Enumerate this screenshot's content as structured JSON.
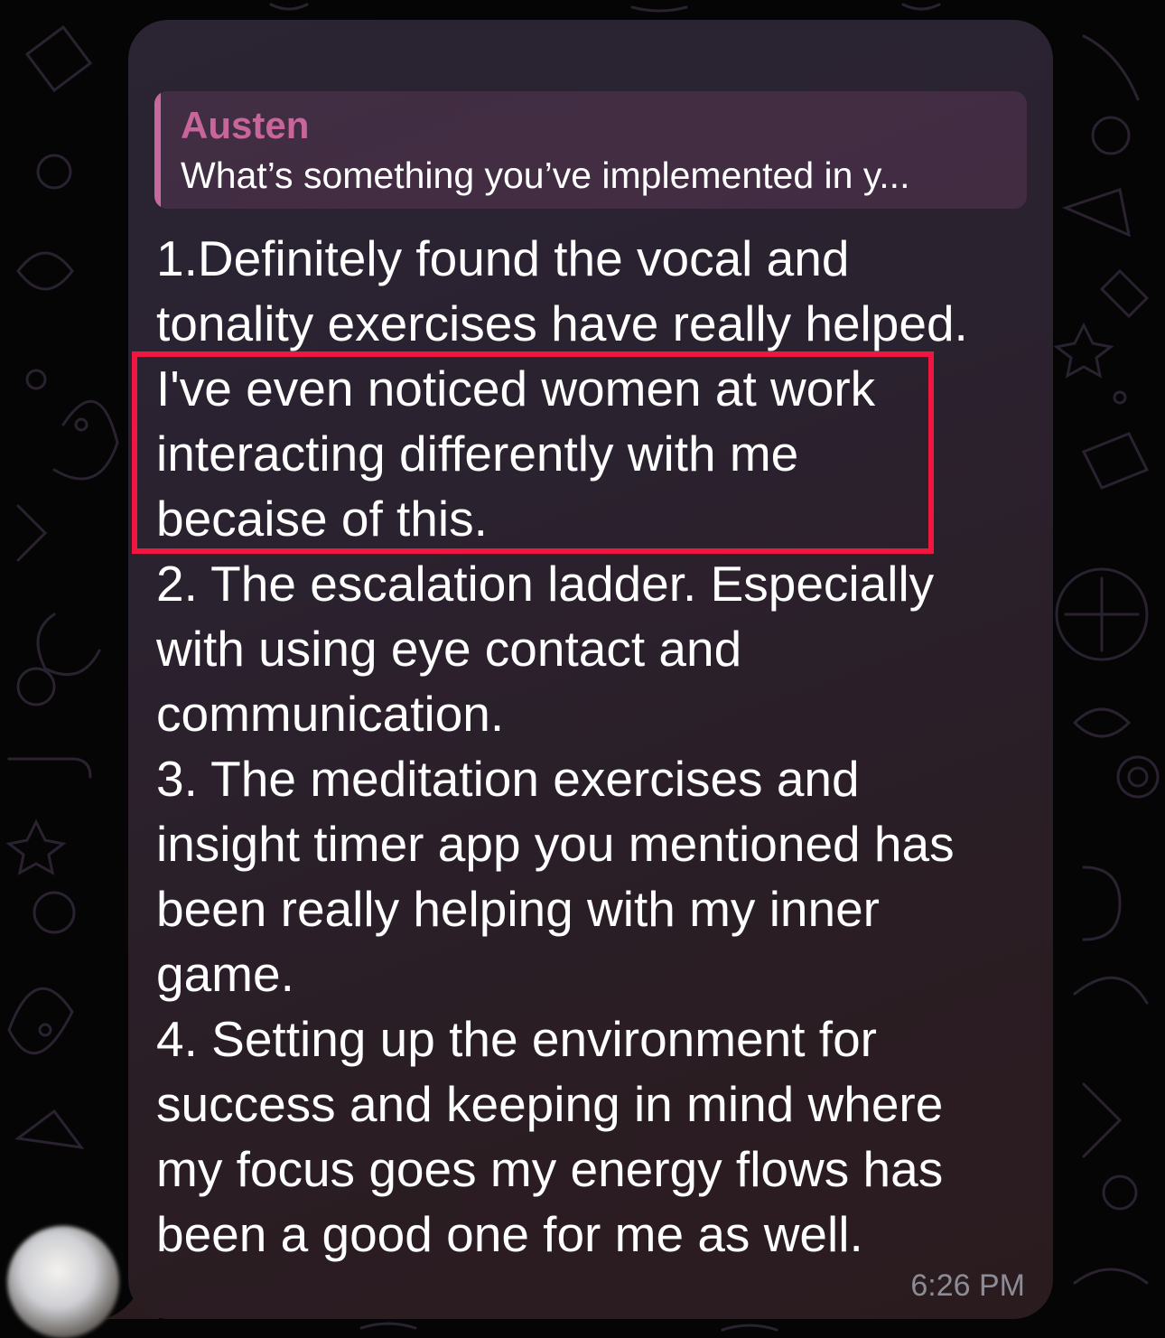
{
  "reply": {
    "author": "Austen",
    "preview": "What’s something you’ve implemented in y..."
  },
  "message": {
    "lines": [
      "1.Definitely found the vocal and",
      "tonality exercises have really helped.",
      "I've even noticed women at work",
      "interacting differently with me",
      "becaise of this.",
      "2. The escalation ladder. Especially",
      "with using eye contact and",
      "communication.",
      "3. The meditation exercises and",
      "insight timer app you mentioned has",
      "been really helping with my inner",
      "game.",
      "4. Setting up the environment for",
      "success and keeping in mind where",
      "my focus goes my energy flows has",
      "been a good one for me as well."
    ],
    "time": "6:26 PM"
  },
  "highlight": {
    "color": "#f0163f",
    "covers_lines": [
      3,
      4,
      5
    ]
  },
  "colors": {
    "background": "#050505",
    "reply_accent": "#c7689f",
    "text": "#ffffff",
    "time": "#8c8c96"
  },
  "avatar": {
    "icon": "user-avatar-photo"
  }
}
